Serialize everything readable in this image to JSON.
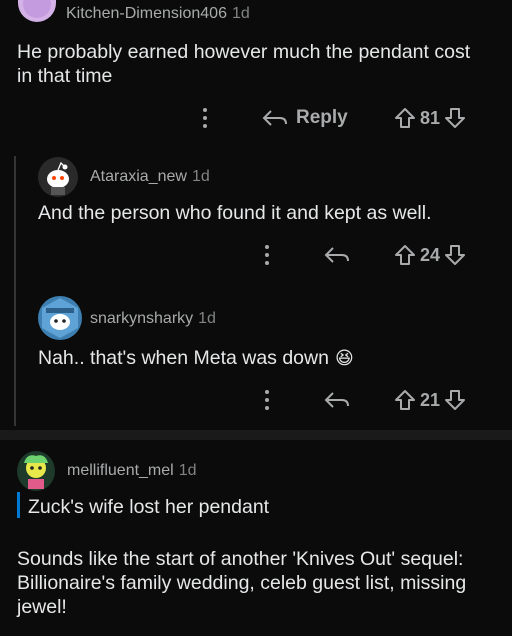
{
  "comments": [
    {
      "username": "Kitchen-Dimension406",
      "age": "1d",
      "body": [
        "He probably earned however much the pendant cost",
        "in that time"
      ],
      "reply_label": "Reply",
      "score": "81"
    },
    {
      "username": "Ataraxia_new",
      "age": "1d",
      "body": [
        "And the person who found it and kept as well."
      ],
      "score": "24"
    },
    {
      "username": "snarkynsharky",
      "age": "1d",
      "body": [
        "Nah.. that's when Meta was down"
      ],
      "emoji": "😆",
      "score": "21"
    },
    {
      "username": "mellifluent_mel",
      "age": "1d",
      "quote": "Zuck's wife lost her pendant",
      "body": [
        "Sounds like the start of another 'Knives Out' sequel:",
        "Billionaire's family wedding, celeb guest list, missing",
        "jewel!"
      ]
    }
  ],
  "icons": [
    "avatar",
    "more-options-icon",
    "reply-arrow-icon",
    "upvote-icon",
    "downvote-icon"
  ],
  "colors": {
    "background": "#0b0b0b",
    "text": "#e6e7e8",
    "meta": "#a8aaab",
    "quote_bar": "#0079d3"
  }
}
